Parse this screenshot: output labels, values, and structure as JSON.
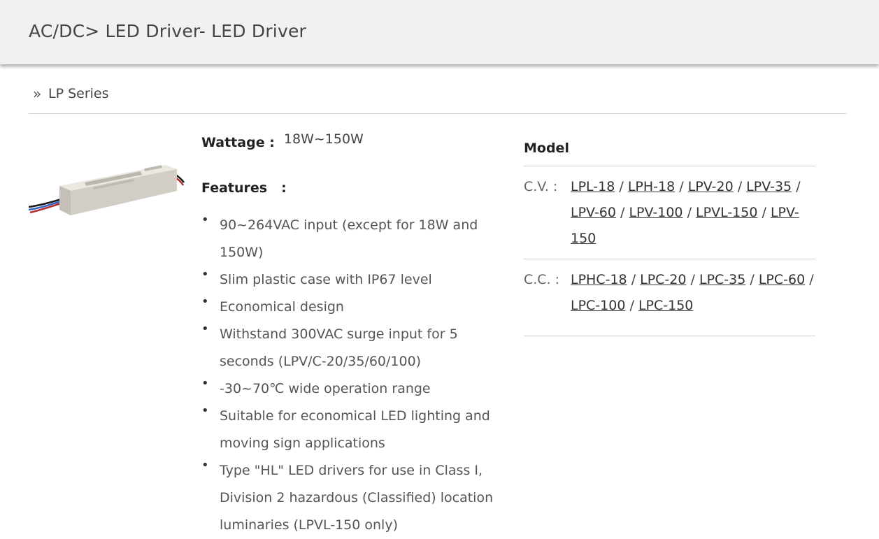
{
  "header": {
    "title": "AC/DC> LED Driver- LED Driver"
  },
  "series": {
    "chevron": "»",
    "label": "LP Series"
  },
  "product": {
    "image_icon": "led-driver-product-image",
    "wattage_label": "Wattage :",
    "wattage_value": "18W~150W",
    "features_label": "Features",
    "features_colon": ":",
    "bullet": "•",
    "features": [
      "90~264VAC input (except for 18W and 150W)",
      "Slim plastic case with IP67 level",
      "Economical design",
      "Withstand 300VAC surge input for 5 seconds (LPV/C-20/35/60/100)",
      "-30~70℃ wide operation range",
      "Suitable for economical LED lighting and moving sign applications",
      "Type \"HL\" LED drivers for use in Class I, Division 2 hazardous (Classified) location luminaries (LPVL-150 only)"
    ]
  },
  "model": {
    "title": "Model",
    "separator": "/",
    "cv": {
      "label": "C.V. :",
      "links": [
        "LPL-18",
        "LPH-18",
        "LPV-20",
        "LPV-35",
        "LPV-60",
        "LPV-100",
        "LPVL-150",
        "LPV-150"
      ]
    },
    "cc": {
      "label": "C.C. :",
      "links": [
        "LPHC-18",
        "LPC-20",
        "LPC-35",
        "LPC-60",
        "LPC-100",
        "LPC-150"
      ]
    }
  },
  "colors": {
    "header_bg": "#f1f1f1",
    "text": "#444444",
    "divider": "#d0d0d0"
  }
}
